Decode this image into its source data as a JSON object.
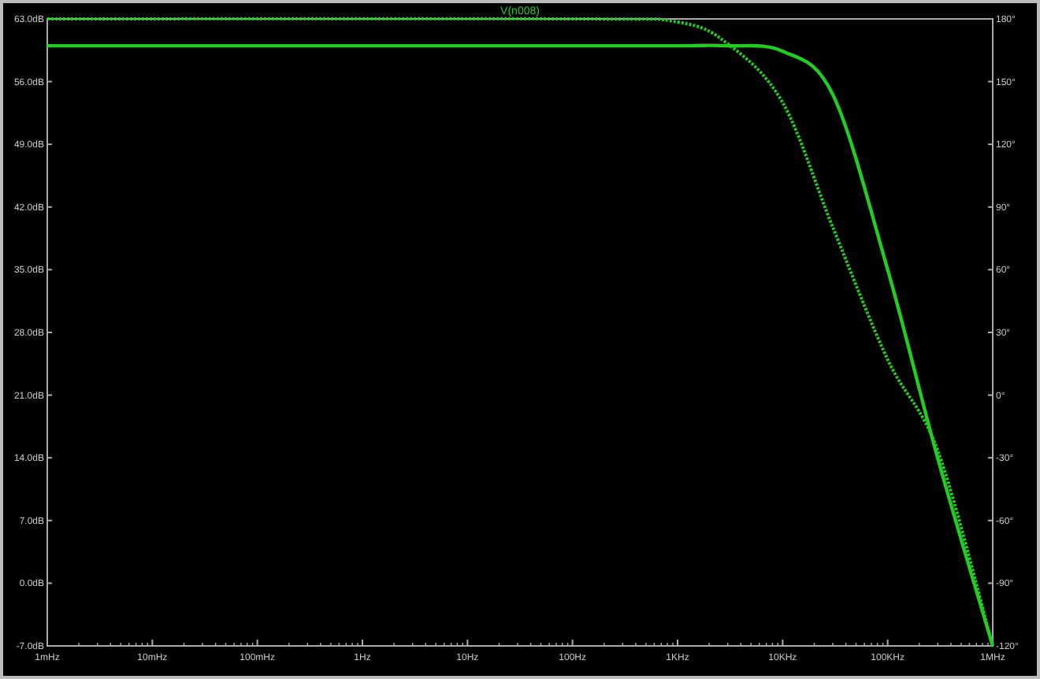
{
  "plot": {
    "title": "V(n008)",
    "x_labels": [
      "1mHz",
      "10mHz",
      "100mHz",
      "1Hz",
      "10Hz",
      "100Hz",
      "1KHz",
      "10KHz",
      "100KHz",
      "1MHz"
    ],
    "left_labels": [
      "63.0dB",
      "56.0dB",
      "49.0dB",
      "42.0dB",
      "35.0dB",
      "28.0dB",
      "21.0dB",
      "14.0dB",
      "7.0dB",
      "0.0dB",
      "-7.0dB"
    ],
    "right_labels": [
      "180°",
      "150°",
      "120°",
      "90°",
      "60°",
      "30°",
      "0°",
      "-30°",
      "-60°",
      "-90°",
      "-120°"
    ]
  }
}
